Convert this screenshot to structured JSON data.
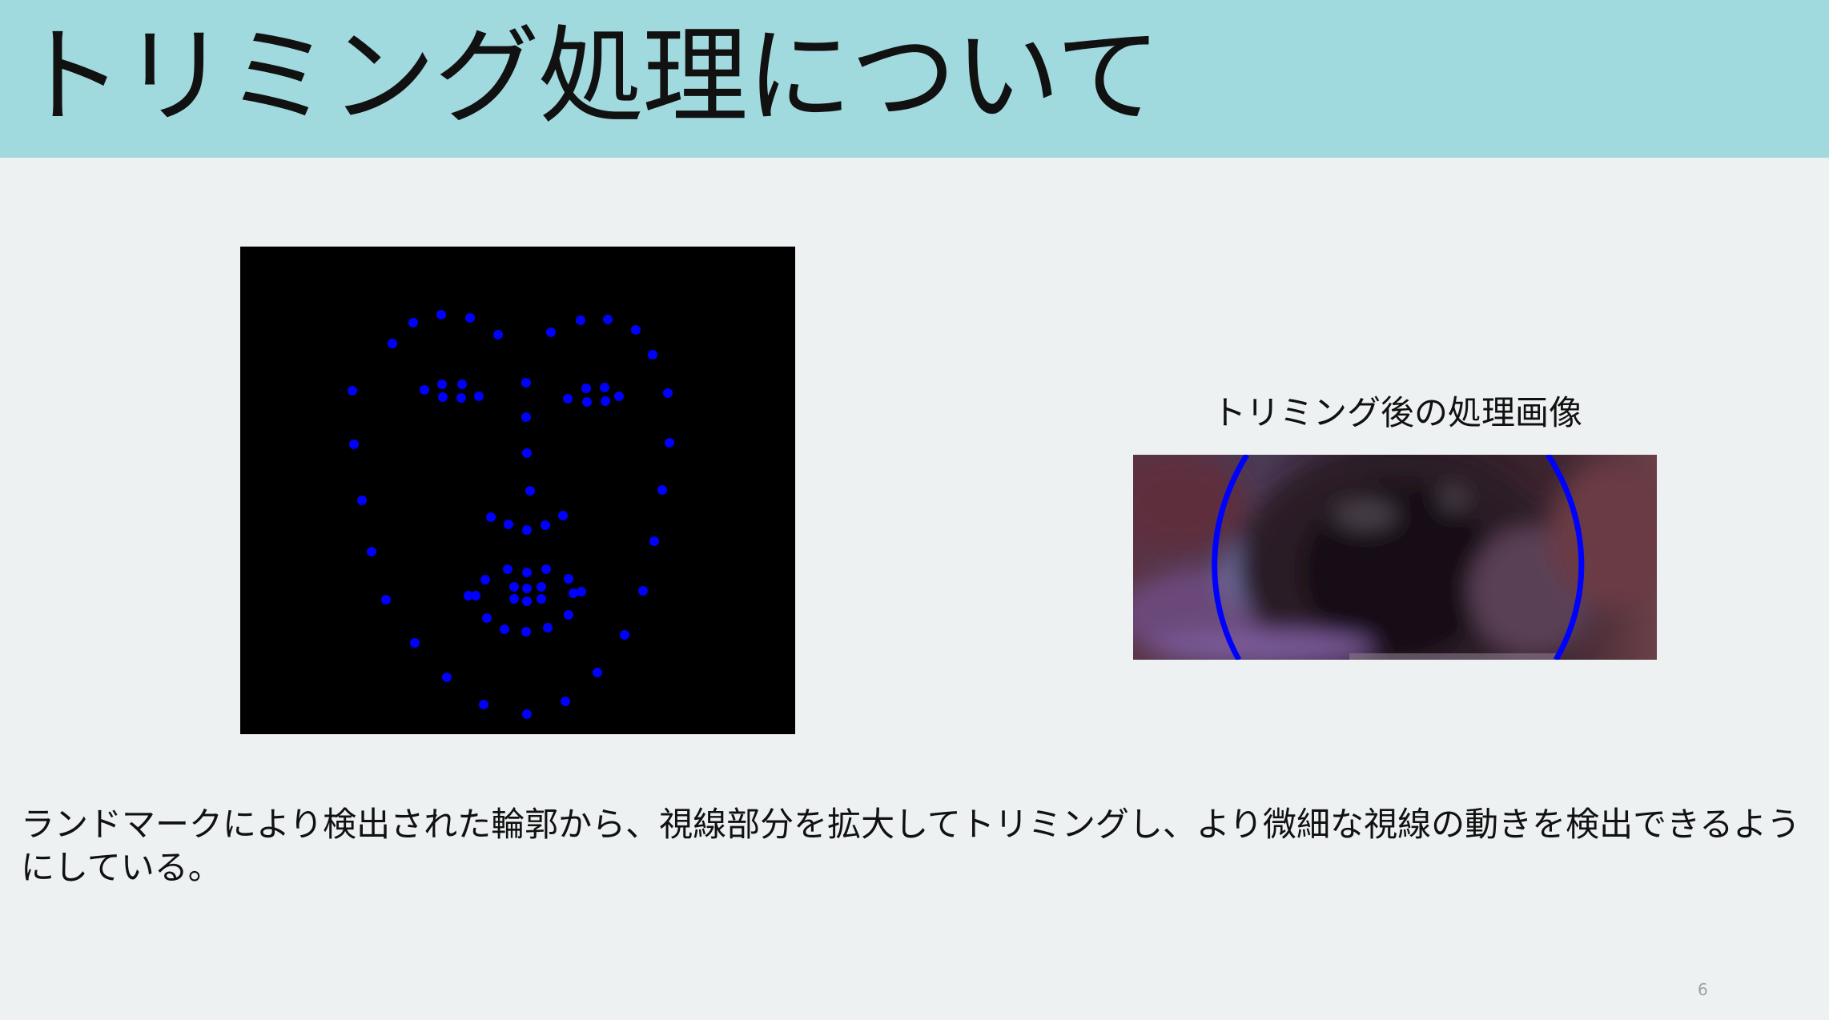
{
  "slide": {
    "title": "トリミング処理について",
    "trimmed_caption": "トリミング後の処理画像",
    "description": "ランドマークにより検出された輪郭から、視線部分を拡大してトリミングし、より微細な視線の動きを検出できるようにしている。",
    "page_number": "6"
  },
  "colors": {
    "title_bar": "#a0d9de",
    "background": "#edf1f2",
    "landmark_dot": "#0000ff"
  }
}
